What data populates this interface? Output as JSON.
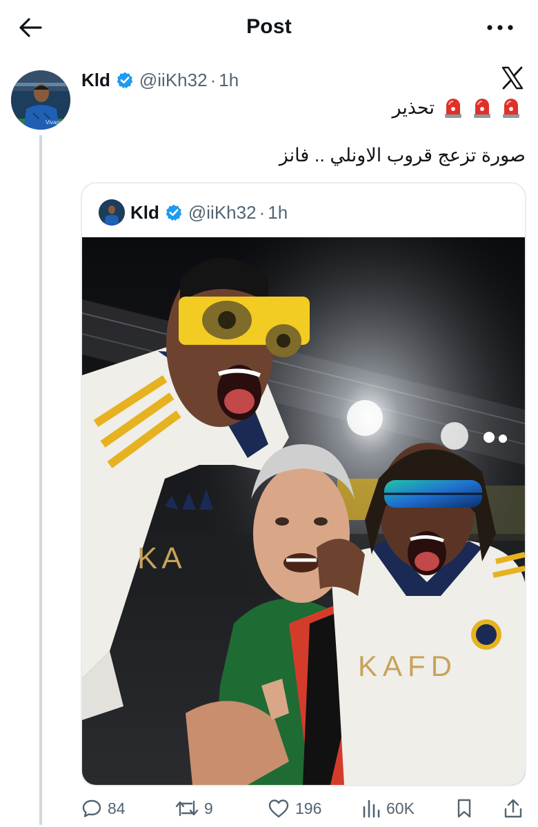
{
  "topbar": {
    "title": "Post",
    "back_icon": "arrow-left-icon",
    "more_icon": "more-horizontal-icon"
  },
  "tweet": {
    "author_name": "Kld",
    "handle": "@iiKh32",
    "separator": "·",
    "time": "1h",
    "line1_text": "تحذير",
    "line1_emoji_count": 3,
    "line1_emoji": "police-car-light-icon",
    "line2_text": "صورة تزعج قروب الاونلي .. فانز"
  },
  "quote": {
    "author_name": "Kld",
    "handle": "@iiKh32",
    "separator": "·",
    "time": "1h",
    "jersey_text_1": "KAFD",
    "jersey_text_2": "KA"
  },
  "actions": {
    "replies": "84",
    "reposts": "9",
    "likes": "196",
    "views": "60K"
  },
  "colors": {
    "accent": "#1d9bf0",
    "text": "#0f1419",
    "muted": "#536471",
    "border": "#e6ecf0",
    "siren_red": "#e0302a"
  }
}
